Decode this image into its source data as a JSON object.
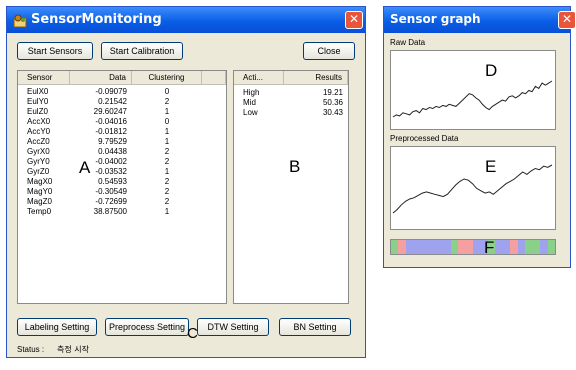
{
  "main_window": {
    "title": "SensorMonitoring",
    "close_glyph": "✕",
    "icon": "sensor-app-icon",
    "buttons": {
      "start_sensors": "Start Sensors",
      "start_calibration": "Start Calibration",
      "close": "Close",
      "labeling_setting": "Labeling Setting",
      "preprocess_setting": "Preprocess Setting",
      "dtw_setting": "DTW Setting",
      "bn_setting": "BN Setting"
    },
    "sensor_table": {
      "headers": [
        "Sensor",
        "Data",
        "Clustering"
      ],
      "rows": [
        [
          "EulX0",
          "-0.09079",
          "0"
        ],
        [
          "EulY0",
          "0.21542",
          "2"
        ],
        [
          "EulZ0",
          "29.60247",
          "1"
        ],
        [
          "AccX0",
          "-0.04016",
          "0"
        ],
        [
          "AccY0",
          "-0.01812",
          "1"
        ],
        [
          "AccZ0",
          "9.79529",
          "1"
        ],
        [
          "GyrX0",
          "0.04438",
          "2"
        ],
        [
          "GyrY0",
          "-0.04002",
          "2"
        ],
        [
          "GyrZ0",
          "-0.03532",
          "1"
        ],
        [
          "MagX0",
          "0.54593",
          "2"
        ],
        [
          "MagY0",
          "-0.30549",
          "2"
        ],
        [
          "MagZ0",
          "-0.72699",
          "2"
        ],
        [
          "Temp0",
          "38.87500",
          "1"
        ]
      ]
    },
    "activity_table": {
      "headers": [
        "Acti...",
        "Results"
      ],
      "rows": [
        [
          "High",
          "19.21"
        ],
        [
          "Mid",
          "50.36"
        ],
        [
          "Low",
          "30.43"
        ]
      ]
    },
    "status_label": "Status :",
    "status_value": "측정 시작"
  },
  "graph_window": {
    "title": "Sensor graph",
    "close_glyph": "✕",
    "raw_label": "Raw Data",
    "pre_label": "Preprocessed Data",
    "raw_series": [
      4,
      6,
      5,
      8,
      7,
      6,
      9,
      10,
      8,
      12,
      11,
      13,
      12,
      14,
      13,
      15,
      14,
      16,
      15,
      14,
      17,
      20,
      23,
      26,
      25,
      22,
      20,
      16,
      13,
      11,
      14,
      16,
      18,
      20,
      19,
      23,
      24,
      22,
      24,
      27,
      26,
      29,
      28,
      33,
      31,
      36,
      34,
      36,
      38
    ],
    "pre_series": [
      6,
      9,
      13,
      16,
      18,
      19,
      21,
      23,
      24,
      23,
      22,
      21,
      20,
      22,
      26,
      30,
      33,
      35,
      34,
      31,
      27,
      25,
      23,
      24,
      22,
      25,
      28,
      31,
      33,
      35,
      38,
      41,
      39,
      42,
      44,
      43,
      46,
      45,
      47
    ],
    "label_bar": [
      "#8ad08a",
      "#f4a0a0",
      "#9fa3ee",
      "#9fa3ee",
      "#9fa3ee",
      "#9fa3ee",
      "#9fa3ee",
      "#9fa3ee",
      "#8ad08a",
      "#f4a0a0",
      "#f4a0a0",
      "#9fa3ee",
      "#9fa3ee",
      "#8ad08a",
      "#9fa3ee",
      "#9fa3ee",
      "#f4a0a0",
      "#9fa3ee",
      "#8ad08a",
      "#8ad08a",
      "#9fa3ee",
      "#8ad08a"
    ]
  },
  "annotations": {
    "A": "A",
    "B": "B",
    "C": "C",
    "D": "D",
    "E": "E",
    "F": "F"
  }
}
